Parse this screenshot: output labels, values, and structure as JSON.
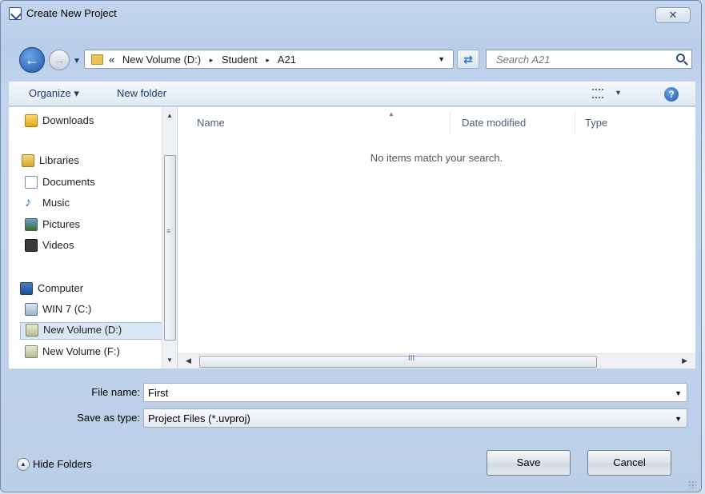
{
  "window": {
    "title": "Create New Project",
    "close_glyph": "✕"
  },
  "address": {
    "prefix": "«",
    "crumbs": [
      "New Volume (D:)",
      "Student",
      "A21"
    ],
    "separator": "▸"
  },
  "search": {
    "placeholder": "Search A21"
  },
  "toolbar": {
    "organize_label": "Organize ▾",
    "new_folder_label": "New folder",
    "view_dropdown": "▾",
    "help": "?"
  },
  "sidebar": {
    "items": [
      {
        "label": "Downloads",
        "icon": "downloads-icon"
      },
      {
        "label": "Libraries",
        "icon": "libraries-icon"
      },
      {
        "label": "Documents",
        "icon": "documents-icon"
      },
      {
        "label": "Music",
        "icon": "music-icon"
      },
      {
        "label": "Pictures",
        "icon": "pictures-icon"
      },
      {
        "label": "Videos",
        "icon": "videos-icon"
      },
      {
        "label": "Computer",
        "icon": "computer-icon"
      },
      {
        "label": "WIN 7 (C:)",
        "icon": "drive-icon"
      },
      {
        "label": "New Volume (D:)",
        "icon": "drive-icon",
        "selected": true
      },
      {
        "label": "New Volume (F:)",
        "icon": "drive-icon"
      }
    ]
  },
  "file_list": {
    "columns": [
      "Name",
      "Date modified",
      "Type"
    ],
    "empty_message": "No items match your search."
  },
  "form": {
    "file_name_label": "File name:",
    "file_name_value": "First",
    "save_type_label": "Save as type:",
    "save_type_value": "Project Files (*.uvproj)"
  },
  "footer": {
    "hide_folders_label": "Hide Folders",
    "save_label": "Save",
    "cancel_label": "Cancel"
  },
  "colors": {
    "accent": "#1f57a8",
    "selection": "#d8e6f6"
  }
}
